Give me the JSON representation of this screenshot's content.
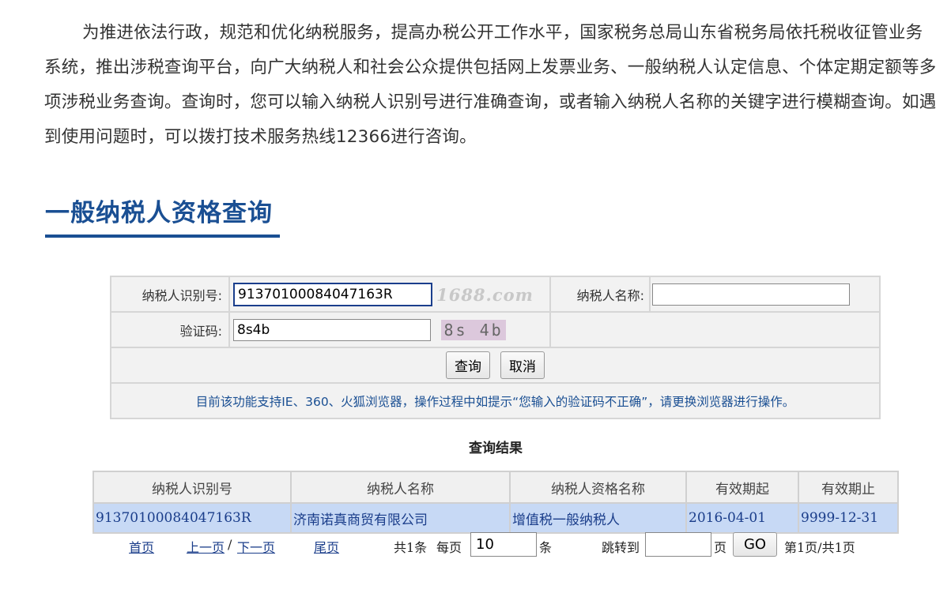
{
  "intro": "为推进依法行政，规范和优化纳税服务，提高办税公开工作水平，国家税务总局山东省税务局依托税收征管业务系统，推出涉税查询平台，向广大纳税人和社会公众提供包括网上发票业务、一般纳税人认定信息、个体定期定额等多项涉税业务查询。查询时，您可以输入纳税人识别号进行准确查询，或者输入纳税人名称的关键字进行模糊查询。如遇到使用问题时，可以拨打技术服务热线12366进行咨询。",
  "section_title": "一般纳税人资格查询",
  "form": {
    "taxpayer_id_label": "纳税人识别号:",
    "taxpayer_id_value": "91370100084047163R",
    "watermark": "1688.com",
    "taxpayer_name_label": "纳税人名称:",
    "taxpayer_name_value": "",
    "captcha_label": "验证码:",
    "captcha_value": "8s4b",
    "captcha_image_text": "8s 4b",
    "query_button": "查询",
    "cancel_button": "取消",
    "notice": "目前该功能支持IE、360、火狐浏览器，操作过程中如提示“您输入的验证码不正确”，请更换浏览器进行操作。"
  },
  "result": {
    "title": "查询结果",
    "headers": [
      "纳税人识别号",
      "纳税人名称",
      "纳税人资格名称",
      "有效期起",
      "有效期止"
    ],
    "rows": [
      [
        "91370100084047163R",
        "济南诺真商贸有限公司",
        "增值税一般纳税人",
        "2016-04-01",
        "9999-12-31"
      ]
    ]
  },
  "pager": {
    "first": "首页",
    "prev": "上一页",
    "sep": "/",
    "next": "下一页",
    "last": "尾页",
    "total": "共1条",
    "per_page_label": "每页",
    "per_page_value": "10",
    "per_page_unit": "条",
    "jump_label": "跳转到",
    "jump_value": "",
    "jump_unit": "页",
    "go_button": "GO",
    "page_info": "第1页/共1页"
  }
}
